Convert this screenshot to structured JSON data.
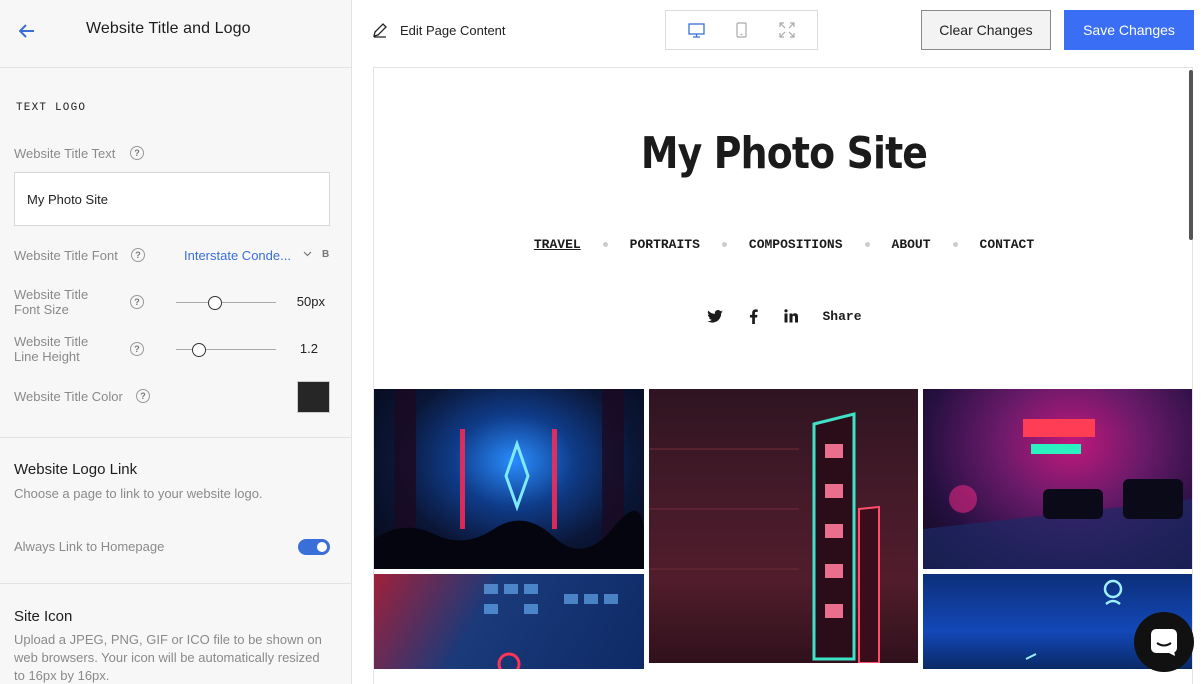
{
  "sidebar": {
    "title": "Website Title and Logo",
    "section_label": "TEXT LOGO",
    "title_text": {
      "label": "Website Title Text",
      "value": "My Photo Site"
    },
    "title_font": {
      "label": "Website Title Font",
      "value": "Interstate Conde...",
      "bold_label": "B"
    },
    "font_size": {
      "label_line1": "Website Title",
      "label_line2": "Font Size",
      "value": "50px",
      "level": 0.39
    },
    "line_height": {
      "label_line1": "Website Title",
      "label_line2": "Line Height",
      "value": "1.2",
      "level": 0.23
    },
    "title_color": {
      "label": "Website Title Color",
      "color": "#262626"
    },
    "logo_link": {
      "title": "Website Logo Link",
      "desc": "Choose a page to link to your website logo.",
      "toggle_label": "Always Link to Homepage",
      "toggle_on": true
    },
    "site_icon": {
      "title": "Site Icon",
      "desc": "Upload a JPEG, PNG, GIF or ICO file to be shown on web browsers. Your icon will be automatically resized to 16px by 16px."
    }
  },
  "topbar": {
    "edit_label": "Edit Page Content",
    "clear_label": "Clear Changes",
    "save_label": "Save Changes"
  },
  "preview": {
    "site_title": "My Photo Site",
    "nav": [
      "TRAVEL",
      "PORTRAITS",
      "COMPOSITIONS",
      "ABOUT",
      "CONTACT"
    ],
    "share_label": "Share"
  },
  "colors": {
    "accent": "#3a6ef5",
    "link": "#3a6ed9"
  }
}
